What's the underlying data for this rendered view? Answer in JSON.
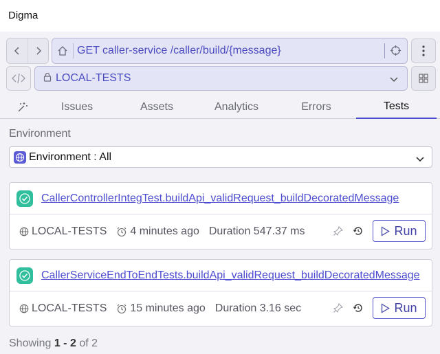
{
  "app": {
    "title": "Digma"
  },
  "nav": {
    "back_icon": "chevron-left-icon",
    "forward_icon": "chevron-right-icon",
    "home_icon": "home-icon",
    "location": "GET caller-service /caller/build/{message}",
    "target_icon": "crosshair-icon",
    "menu_icon": "kebab-menu-icon"
  },
  "scope": {
    "code_icon": "code-icon",
    "lock_icon": "lock-icon",
    "environment": "LOCAL-TESTS",
    "dropdown_icon": "chevron-down-icon",
    "grid_icon": "grid-icon"
  },
  "tabs": [
    {
      "label": "Issues"
    },
    {
      "label": "Assets"
    },
    {
      "label": "Analytics"
    },
    {
      "label": "Errors"
    },
    {
      "label": "Tests",
      "active": true
    }
  ],
  "filter": {
    "label": "Environment",
    "value": "Environment : All"
  },
  "tests": [
    {
      "name": "CallerControllerIntegTest.buildApi_validRequest_buildDecoratedMessage",
      "environment": "LOCAL-TESTS",
      "time": "4 minutes ago",
      "duration": "Duration 547.37 ms",
      "status": "success",
      "run_label": "Run"
    },
    {
      "name": "CallerServiceEndToEndTests.buildApi_validRequest_buildDecoratedMessage",
      "environment": "LOCAL-TESTS",
      "time": "15 minutes ago",
      "duration": "Duration 3.16 sec",
      "status": "success",
      "run_label": "Run"
    }
  ],
  "pagination": {
    "prefix": "Showing",
    "range_start": "1",
    "separator": " - ",
    "range_end": "2",
    "of_label": "of",
    "total": "2"
  },
  "colors": {
    "accent": "#4d4dd2",
    "success": "#2fbf9c",
    "field_bg": "#e4e4f7"
  }
}
